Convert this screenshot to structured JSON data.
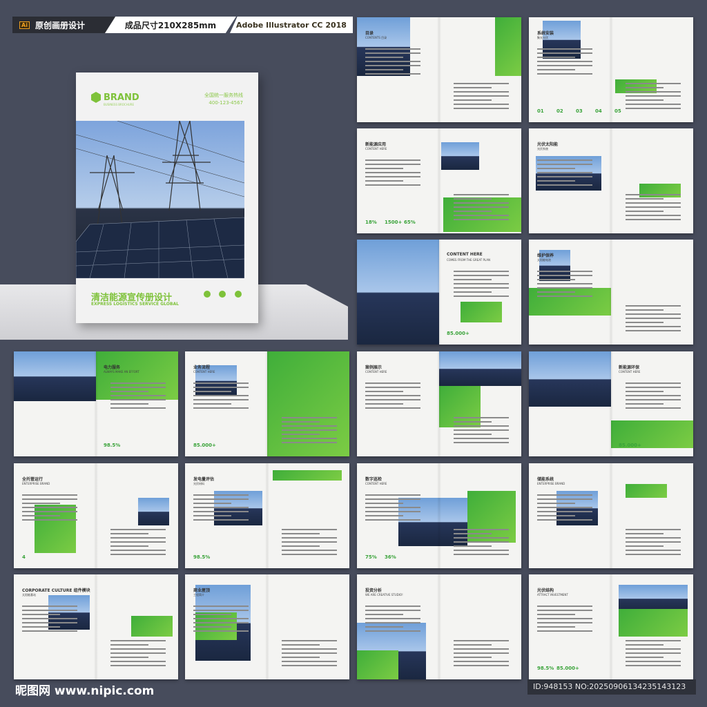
{
  "header": {
    "label": "原创画册设计",
    "ai_badge": "Ai",
    "size": "成品尺寸210X285mm",
    "software": "Adobe Illustrator CC 2018"
  },
  "cover": {
    "brand": "BRAND",
    "brand_sub": "BUSINESS BROCHURE",
    "hotline_label": "全国统一服务热线",
    "hotline": "400-123-4567",
    "title": "清洁能源宣传册设计",
    "subtitle": "EXPRESS LOGISTICS SERVICE GLOBAL"
  },
  "spreads": [
    {
      "title": "目录",
      "sub": "CONTENTS 目录",
      "stats": []
    },
    {
      "title": "系统安装",
      "sub": "聚光光伏",
      "stats": [
        "01",
        "02",
        "03",
        "04",
        "05"
      ]
    },
    {
      "title": "新能源应用",
      "sub": "CONTENT HERE",
      "stats": [
        "18%",
        "1500+",
        "65%"
      ]
    },
    {
      "title": "光伏太阳能",
      "sub": "光伏系统",
      "stats": []
    },
    {
      "title": "CONTENT HERE",
      "sub": "COMES FROM THE GREAT PLAN",
      "stats": [
        "85.000+"
      ]
    },
    {
      "title": "维护保养",
      "sub": "太阳能电池",
      "stats": []
    },
    {
      "title": "电力服务",
      "sub": "ALWAYS MAKE AN EFFORT",
      "stats": [
        "98.5%"
      ]
    },
    {
      "title": "业务流程",
      "sub": "CONTENT HERE",
      "stats": [
        "85.000+"
      ]
    },
    {
      "title": "案例展示",
      "sub": "CONTENT HERE",
      "stats": []
    },
    {
      "title": "新能源环保",
      "sub": "CONTENT HERE",
      "stats": [
        "85.000+"
      ]
    },
    {
      "title": "全托管运行",
      "sub": "ENTERPRISE BRAND",
      "stats": [
        "4"
      ]
    },
    {
      "title": "发电量评估",
      "sub": "光伏材料",
      "stats": [
        "98.5%"
      ]
    },
    {
      "title": "数字巡检",
      "sub": "CONTENT HERE",
      "stats": [
        "75%",
        "36%"
      ]
    },
    {
      "title": "储能系统",
      "sub": "ENTERPRISE BRAND",
      "stats": []
    },
    {
      "title": "CORPORATE CULTURE 组件模块",
      "sub": "太阳能基站",
      "stats": []
    },
    {
      "title": "商业屋顶",
      "sub": "工程简介",
      "stats": []
    },
    {
      "title": "投资分析",
      "sub": "WE ARE CREATIVE STUDIO!",
      "stats": []
    },
    {
      "title": "光伏结构",
      "sub": "ATTRACT INVESTMENT",
      "stats": [
        "98.5%",
        "85.000+"
      ]
    }
  ],
  "footer": {
    "watermark": "昵图网 www.nipic.com",
    "id": "ID:948153 NO:20250906134235143123"
  },
  "colors": {
    "green": "#5cbb3f",
    "bg": "#474c5c"
  }
}
